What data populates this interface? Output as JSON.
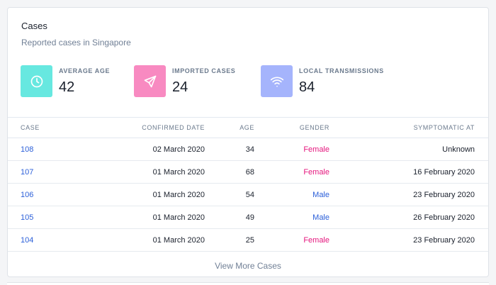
{
  "card": {
    "title": "Cases",
    "subtitle": "Reported cases in Singapore"
  },
  "stats": [
    {
      "label": "Average Age",
      "value": "42",
      "icon": "clock-icon",
      "color": "#67e8e0"
    },
    {
      "label": "Imported Cases",
      "value": "24",
      "icon": "send-icon",
      "color": "#f88ac1"
    },
    {
      "label": "Local Transmissions",
      "value": "84",
      "icon": "wifi-icon",
      "color": "#a5b4fc"
    }
  ],
  "table": {
    "headers": {
      "case": "Case",
      "date": "Confirmed Date",
      "age": "Age",
      "gender": "Gender",
      "symptomatic": "Symptomatic At"
    },
    "rows": [
      {
        "case": "108",
        "date": "02 March 2020",
        "age": "34",
        "gender": "Female",
        "symptomatic": "Unknown"
      },
      {
        "case": "107",
        "date": "01 March 2020",
        "age": "68",
        "gender": "Female",
        "symptomatic": "16 February 2020"
      },
      {
        "case": "106",
        "date": "01 March 2020",
        "age": "54",
        "gender": "Male",
        "symptomatic": "23 February 2020"
      },
      {
        "case": "105",
        "date": "01 March 2020",
        "age": "49",
        "gender": "Male",
        "symptomatic": "26 February 2020"
      },
      {
        "case": "104",
        "date": "01 March 2020",
        "age": "25",
        "gender": "Female",
        "symptomatic": "23 February 2020"
      }
    ]
  },
  "footer": {
    "view_more_label": "View More Cases"
  }
}
